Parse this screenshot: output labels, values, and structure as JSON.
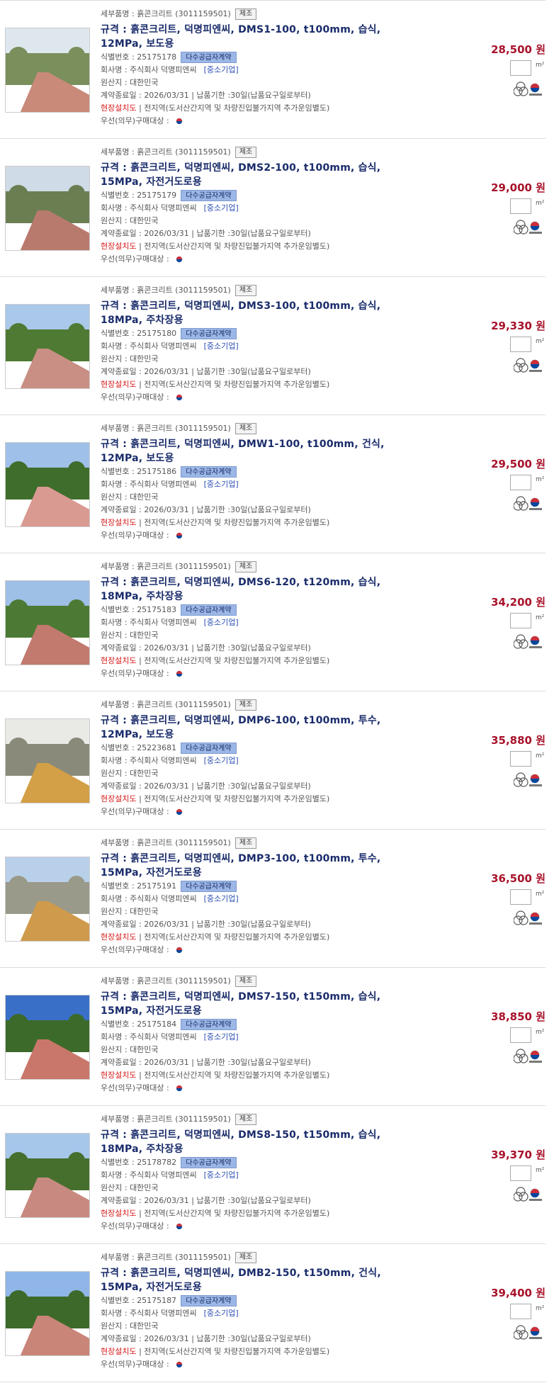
{
  "labels": {
    "detail_prefix": "세부품명 : ",
    "id_prefix": "식별번호 : ",
    "company_prefix": "회사명 : ",
    "origin_prefix": "원산지 : ",
    "contract_prefix": "계약종료일 : ",
    "site_install": "현장설치도",
    "priority_purchase": "우선(의무)구매대상 : ",
    "multi_supplier": "다수공급자계약",
    "manufacture": "제조",
    "unit": "m²"
  },
  "products": [
    {
      "detail": "흙콘크리트 (3011159501)",
      "title_line1": "규격 : 흙콘크리트, 덕명피엔씨, DMS1-100, t100mm, 습식,",
      "title_line2": "12MPa, 보도용",
      "id": "25175178",
      "company": "주식회사 덕명피엔씨",
      "sme": "[중소기업]",
      "origin": "대한민국",
      "contract": "2026/03/31 | 납품기한 :30일(납품요구일로부터)",
      "site": " | 전지역(도서산간지역 및 차량진입불가지역 추가운임별도)",
      "price": "28,500 원"
    },
    {
      "detail": "흙콘크리트 (3011159501)",
      "title_line1": "규격 : 흙콘크리트, 덕명피엔씨, DMS2-100, t100mm, 습식,",
      "title_line2": "15MPa, 자전거도로용",
      "id": "25175179",
      "company": "주식회사 덕명피엔씨",
      "sme": "[중소기업]",
      "origin": "대한민국",
      "contract": "2026/03/31 | 납품기한 :30일(납품요구일로부터)",
      "site": " | 전지역(도서산간지역 및 차량진입불가지역 추가운임별도)",
      "price": "29,000 원"
    },
    {
      "detail": "흙콘크리트 (3011159501)",
      "title_line1": "규격 : 흙콘크리트, 덕명피엔씨, DMS3-100, t100mm, 습식,",
      "title_line2": "18MPa, 주차장용",
      "id": "25175180",
      "company": "주식회사 덕명피엔씨",
      "sme": "[중소기업]",
      "origin": "대한민국",
      "contract": "2026/03/31 | 납품기한 :30일(납품요구일로부터)",
      "site": " | 전지역(도서산간지역 및 차량진입불가지역 추가운임별도)",
      "price": "29,330 원"
    },
    {
      "detail": "흙콘크리트 (3011159501)",
      "title_line1": "규격 : 흙콘크리트, 덕명피엔씨, DMW1-100, t100mm, 건식,",
      "title_line2": "12MPa, 보도용",
      "id": "25175186",
      "company": "주식회사 덕명피엔씨",
      "sme": "[중소기업]",
      "origin": "대한민국",
      "contract": "2026/03/31 | 납품기한 :30일(납품요구일로부터)",
      "site": " | 전지역(도서산간지역 및 차량진입불가지역 추가운임별도)",
      "price": "29,500 원"
    },
    {
      "detail": "흙콘크리트 (3011159501)",
      "title_line1": "규격 : 흙콘크리트, 덕명피엔씨, DMS6-120, t120mm, 습식,",
      "title_line2": "18MPa, 주차장용",
      "id": "25175183",
      "company": "주식회사 덕명피엔씨",
      "sme": "[중소기업]",
      "origin": "대한민국",
      "contract": "2026/03/31 | 납품기한 :30일(납품요구일로부터)",
      "site": " | 전지역(도서산간지역 및 차량진입불가지역 추가운임별도)",
      "price": "34,200 원"
    },
    {
      "detail": "흙콘크리트 (3011159501)",
      "title_line1": "규격 : 흙콘크리트, 덕명피엔씨, DMP6-100, t100mm, 투수,",
      "title_line2": "12MPa, 보도용",
      "id": "25223681",
      "company": "주식회사 덕명피엔씨",
      "sme": "[중소기업]",
      "origin": "대한민국",
      "contract": "2026/03/31 | 납품기한 :30일(납품요구일로부터)",
      "site": " | 전지역(도서산간지역 및 차량진입불가지역 추가운임별도)",
      "price": "35,880 원"
    },
    {
      "detail": "흙콘크리트 (3011159501)",
      "title_line1": "규격 : 흙콘크리트, 덕명피엔씨, DMP3-100, t100mm, 투수,",
      "title_line2": "15MPa, 자전거도로용",
      "id": "25175191",
      "company": "주식회사 덕명피엔씨",
      "sme": "[중소기업]",
      "origin": "대한민국",
      "contract": "2026/03/31 | 납품기한 :30일(납품요구일로부터)",
      "site": " | 전지역(도서산간지역 및 차량진입불가지역 추가운임별도)",
      "price": "36,500 원"
    },
    {
      "detail": "흙콘크리트 (3011159501)",
      "title_line1": "규격 : 흙콘크리트, 덕명피엔씨, DMS7-150, t150mm, 습식,",
      "title_line2": "15MPa, 자전거도로용",
      "id": "25175184",
      "company": "주식회사 덕명피엔씨",
      "sme": "[중소기업]",
      "origin": "대한민국",
      "contract": "2026/03/31 | 납품기한 :30일(납품요구일로부터)",
      "site": " | 전지역(도서산간지역 및 차량진입불가지역 추가운임별도)",
      "price": "38,850 원"
    },
    {
      "detail": "흙콘크리트 (3011159501)",
      "title_line1": "규격 : 흙콘크리트, 덕명피엔씨, DMS8-150, t150mm, 습식,",
      "title_line2": "18MPa, 주차장용",
      "id": "25178782",
      "company": "주식회사 덕명피엔씨",
      "sme": "[중소기업]",
      "origin": "대한민국",
      "contract": "2026/03/31 | 납품기한 :30일(납품요구일로부터)",
      "site": " | 전지역(도서산간지역 및 차량진입불가지역 추가운임별도)",
      "price": "39,370 원"
    },
    {
      "detail": "흙콘크리트 (3011159501)",
      "title_line1": "규격 : 흙콘크리트, 덕명피엔씨, DMB2-150, t150mm, 건식,",
      "title_line2": "15MPa, 자전거도로용",
      "id": "25175187",
      "company": "주식회사 덕명피엔씨",
      "sme": "[중소기업]",
      "origin": "대한민국",
      "contract": "2026/03/31 | 납품기한 :30일(납품요구일로부터)",
      "site": " | 전지역(도서산간지역 및 차량진입불가지역 추가운임별도)",
      "price": "39,400 원"
    }
  ],
  "thumb_colors": [
    {
      "sky": "#dfe7ee",
      "green": "#7a8f5c",
      "ground": "#c98a7a"
    },
    {
      "sky": "#cfdbe6",
      "green": "#6b7e52",
      "ground": "#b97a6e"
    },
    {
      "sky": "#a9c8ea",
      "green": "#4f7a33",
      "ground": "#c98f84"
    },
    {
      "sky": "#9fc0e8",
      "green": "#3f6d2b",
      "ground": "#d99a92"
    },
    {
      "sky": "#9ebfe6",
      "green": "#4c7a34",
      "ground": "#c27a6e"
    },
    {
      "sky": "#e9e9e6",
      "green": "#8a8a7a",
      "ground": "#d3a047"
    },
    {
      "sky": "#b9d0ea",
      "green": "#9a9a8a",
      "ground": "#cf9a4c"
    },
    {
      "sky": "#3a6fc8",
      "green": "#3c6a2a",
      "ground": "#c9776a"
    },
    {
      "sky": "#a6c6ea",
      "green": "#466f2e",
      "ground": "#c88a80"
    },
    {
      "sky": "#8fb6e6",
      "green": "#3d6a2a",
      "ground": "#c98578"
    }
  ]
}
